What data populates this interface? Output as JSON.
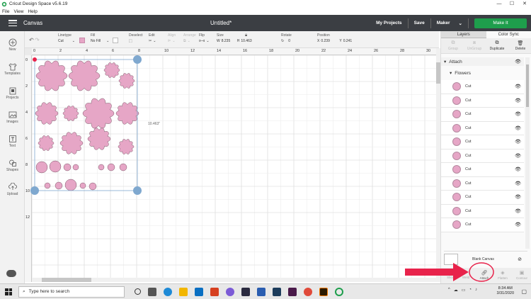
{
  "window": {
    "title": "Cricut Design Space  v5.6.19",
    "controls": [
      "—",
      "☐",
      "✕"
    ]
  },
  "menu": [
    "File",
    "View",
    "Help"
  ],
  "header": {
    "section": "Canvas",
    "document_title": "Untitled*",
    "my_projects": "My Projects",
    "save": "Save",
    "machine": "Maker",
    "make_button": "Make It",
    "accent_color": "#1e9e4c"
  },
  "toolbar": {
    "linetype_label": "Linetype",
    "linetype_value": "Cut",
    "fill_label": "Fill",
    "fill_value": "No Fill",
    "deselect_label": "Deselect",
    "edit_label": "Edit",
    "align_label": "Align",
    "arrange_label": "Arrange",
    "flip_label": "Flip",
    "size_label": "Size",
    "w_label": "W",
    "w_value": "8.235",
    "h_label": "H",
    "h_value": "10.463",
    "rotate_label": "Rotate",
    "rotate_value": "0",
    "position_label": "Position",
    "x_label": "X",
    "x_value": "0.239",
    "y_label": "Y",
    "y_value": "0.241",
    "fill_color": "#e6a6c6"
  },
  "sidebar": {
    "items": [
      {
        "label": "New",
        "icon": "plus-icon"
      },
      {
        "label": "Templates",
        "icon": "shirt-icon"
      },
      {
        "label": "Projects",
        "icon": "projects-icon"
      },
      {
        "label": "Images",
        "icon": "image-icon"
      },
      {
        "label": "Text",
        "icon": "text-icon"
      },
      {
        "label": "Shapes",
        "icon": "shapes-icon"
      },
      {
        "label": "Upload",
        "icon": "upload-icon"
      }
    ]
  },
  "canvas": {
    "ruler_top": [
      "0",
      "2",
      "4",
      "6",
      "8",
      "10",
      "12",
      "14",
      "16",
      "18",
      "20",
      "22",
      "24",
      "26",
      "28",
      "30"
    ],
    "ruler_left": [
      "0",
      "2",
      "4",
      "6",
      "8",
      "10",
      "12"
    ],
    "dimension_label": "10.463\"",
    "shape_color": "#e6a6c6",
    "outline_color": "#5b6e8a"
  },
  "panel": {
    "tabs": [
      "Layers",
      "Color Sync"
    ],
    "actions": [
      "Group",
      "UnGroup",
      "Duplicate",
      "Delete"
    ],
    "attach_label": "Attach",
    "flowers_label": "Flowers",
    "layer_rows": [
      "Cut",
      "Cut",
      "Cut",
      "Cut",
      "Cut",
      "Cut",
      "Cut",
      "Cut",
      "Cut",
      "Cut",
      "Cut"
    ],
    "blank_canvas": "Blank Canvas",
    "bottom_actions": [
      "Slice",
      "Weld",
      "Attach",
      "Flatten",
      "Contour"
    ]
  },
  "annotation": {
    "arrow_color": "#e8234b"
  },
  "taskbar": {
    "search_placeholder": "Type here to search",
    "time": "8:34 AM",
    "date": "3/31/2020"
  }
}
